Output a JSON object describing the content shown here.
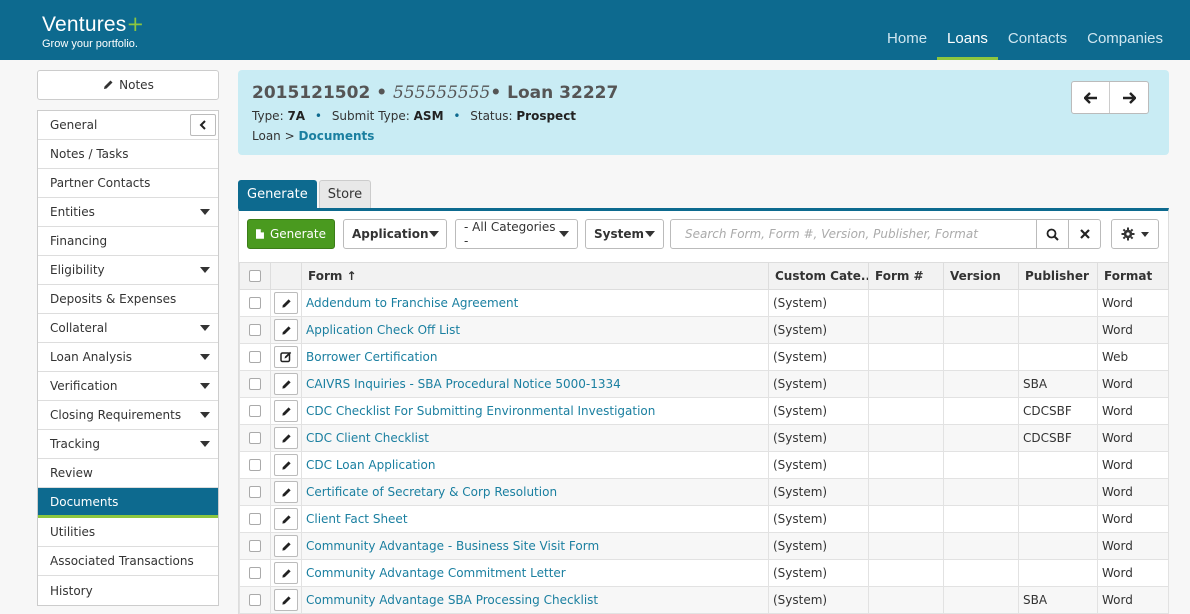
{
  "header": {
    "logo_name": "Ventures",
    "logo_plus": "+",
    "tagline": "Grow your portfolio.",
    "nav": [
      {
        "label": "Home"
      },
      {
        "label": "Loans",
        "active": true
      },
      {
        "label": "Contacts"
      },
      {
        "label": "Companies"
      }
    ]
  },
  "sidebar": {
    "notes_label": "Notes",
    "items": [
      {
        "label": "General",
        "collapse": true
      },
      {
        "label": "Notes / Tasks"
      },
      {
        "label": "Partner Contacts"
      },
      {
        "label": "Entities",
        "caret": true
      },
      {
        "label": "Financing"
      },
      {
        "label": "Eligibility",
        "caret": true
      },
      {
        "label": "Deposits & Expenses"
      },
      {
        "label": "Collateral",
        "caret": true
      },
      {
        "label": "Loan Analysis",
        "caret": true
      },
      {
        "label": "Verification",
        "caret": true
      },
      {
        "label": "Closing Requirements",
        "caret": true
      },
      {
        "label": "Tracking",
        "caret": true
      },
      {
        "label": "Review"
      },
      {
        "label": "Documents",
        "active": true
      },
      {
        "label": "Utilities"
      },
      {
        "label": "Associated Transactions"
      },
      {
        "label": "History"
      }
    ]
  },
  "loan": {
    "number": "2015121502",
    "bullet": "•",
    "ssn": "555555555",
    "name": "Loan 32227",
    "type_label": "Type:",
    "type_value": "7A",
    "submit_label": "Submit Type:",
    "submit_value": "ASM",
    "status_label": "Status:",
    "status_value": "Prospect",
    "crumb_root": "Loan",
    "crumb_sep": ">",
    "crumb_current": "Documents"
  },
  "tabs": [
    {
      "label": "Generate",
      "active": true
    },
    {
      "label": "Store"
    }
  ],
  "toolbar": {
    "generate_label": "Generate",
    "filter1": "Application",
    "filter2": "- All Categories -",
    "filter3": "System",
    "search_placeholder": "Search Form, Form #, Version, Publisher, Format"
  },
  "table": {
    "columns": [
      "Form ↑",
      "Custom Cate...",
      "Form #",
      "Version",
      "Publisher",
      "Format"
    ],
    "rows": [
      {
        "icon": "pencil",
        "form": "Addendum to Franchise Agreement",
        "category": "(System)",
        "form_no": "",
        "version": "",
        "publisher": "",
        "format": "Word"
      },
      {
        "icon": "pencil",
        "form": "Application Check Off List",
        "category": "(System)",
        "form_no": "",
        "version": "",
        "publisher": "",
        "format": "Word"
      },
      {
        "icon": "edit-box",
        "form": "Borrower Certification",
        "category": "(System)",
        "form_no": "",
        "version": "",
        "publisher": "",
        "format": "Web"
      },
      {
        "icon": "pencil",
        "form": "CAIVRS Inquiries - SBA Procedural Notice 5000-1334",
        "category": "(System)",
        "form_no": "",
        "version": "",
        "publisher": "SBA",
        "format": "Word"
      },
      {
        "icon": "pencil",
        "form": "CDC Checklist For Submitting Environmental Investigation",
        "category": "(System)",
        "form_no": "",
        "version": "",
        "publisher": "CDCSBF",
        "format": "Word"
      },
      {
        "icon": "pencil",
        "form": "CDC Client Checklist",
        "category": "(System)",
        "form_no": "",
        "version": "",
        "publisher": "CDCSBF",
        "format": "Word"
      },
      {
        "icon": "pencil",
        "form": "CDC Loan Application",
        "category": "(System)",
        "form_no": "",
        "version": "",
        "publisher": "",
        "format": "Word"
      },
      {
        "icon": "pencil",
        "form": "Certificate of Secretary & Corp Resolution",
        "category": "(System)",
        "form_no": "",
        "version": "",
        "publisher": "",
        "format": "Word"
      },
      {
        "icon": "pencil",
        "form": "Client Fact Sheet",
        "category": "(System)",
        "form_no": "",
        "version": "",
        "publisher": "",
        "format": "Word"
      },
      {
        "icon": "pencil",
        "form": "Community Advantage - Business Site Visit Form",
        "category": "(System)",
        "form_no": "",
        "version": "",
        "publisher": "",
        "format": "Word"
      },
      {
        "icon": "pencil",
        "form": "Community Advantage Commitment Letter",
        "category": "(System)",
        "form_no": "",
        "version": "",
        "publisher": "",
        "format": "Word"
      },
      {
        "icon": "pencil",
        "form": "Community Advantage SBA Processing Checklist",
        "category": "(System)",
        "form_no": "",
        "version": "",
        "publisher": "SBA",
        "format": "Word"
      }
    ]
  },
  "colors": {
    "brand": "#0d6a8f",
    "accent": "#8cc63f",
    "generate": "#4a9a1f",
    "link": "#1a7fa0"
  }
}
